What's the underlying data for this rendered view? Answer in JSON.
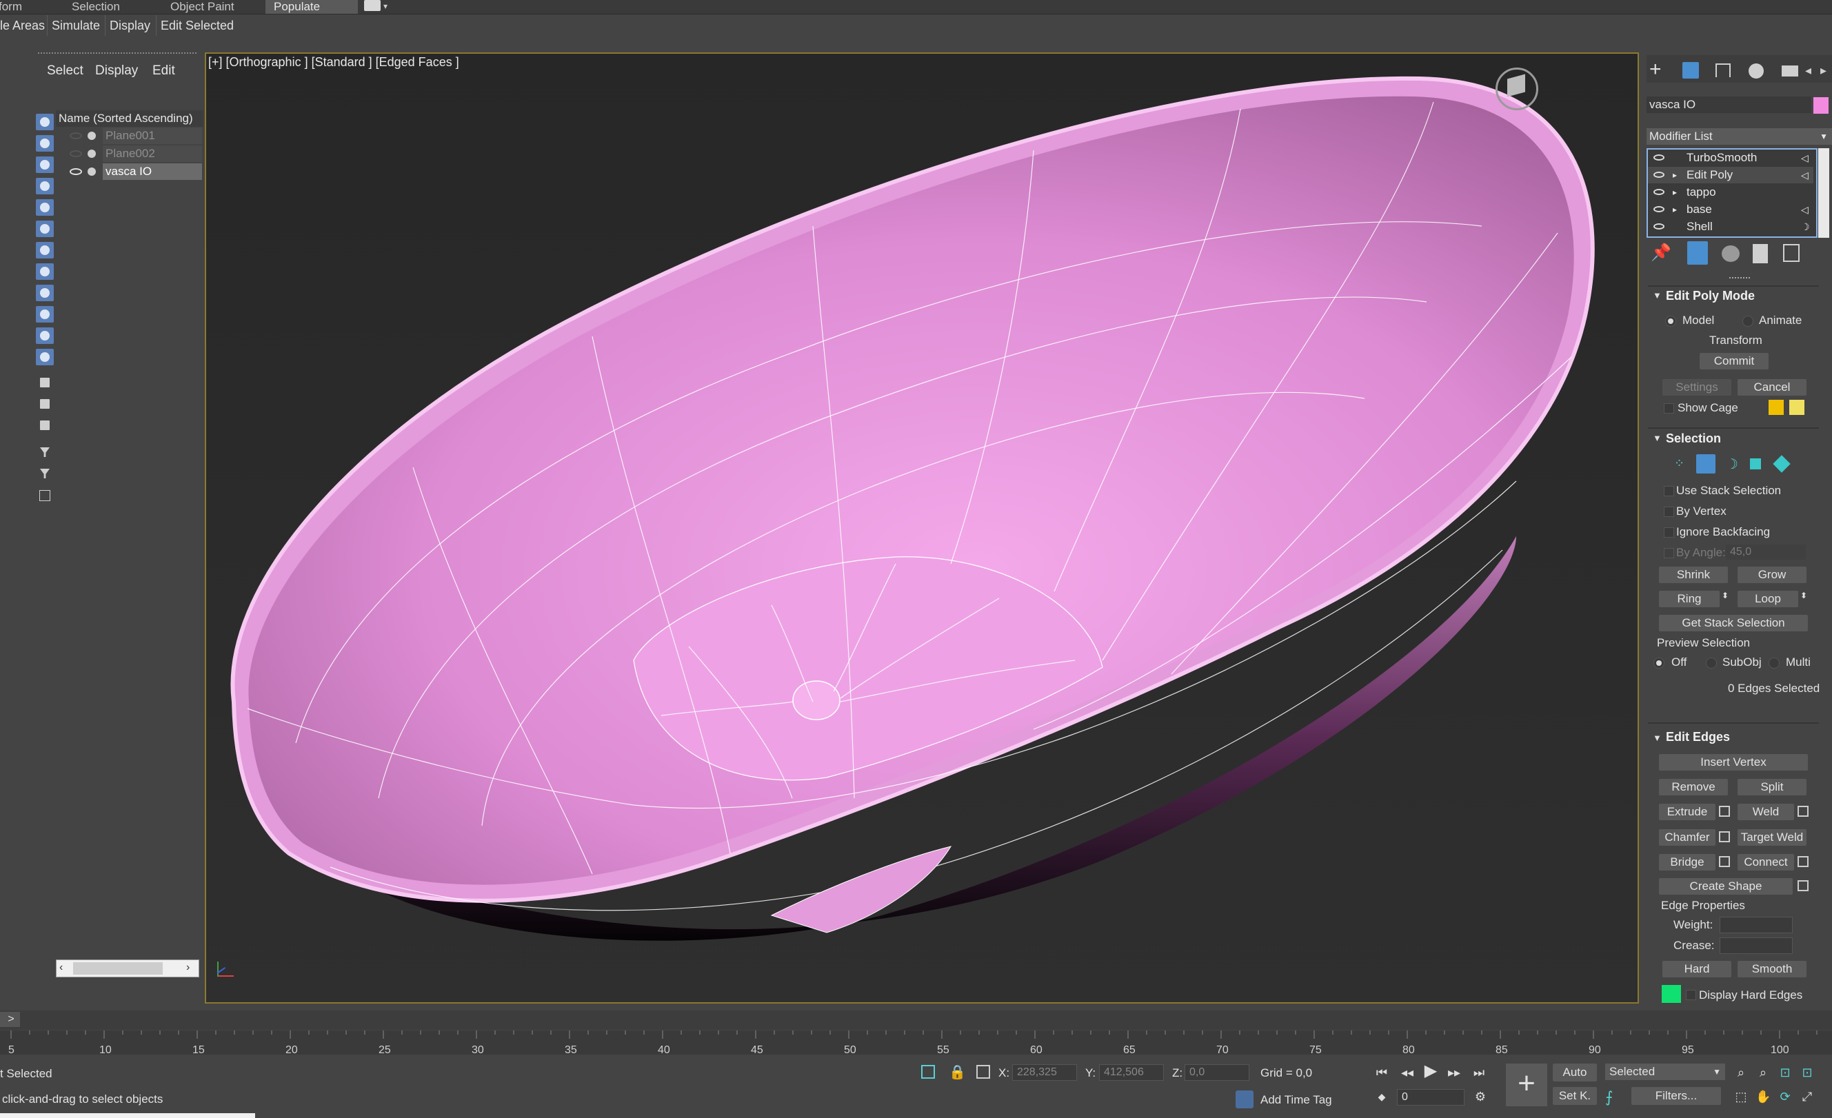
{
  "ribbon": {
    "tabs": [
      "form",
      "Selection",
      "Object Paint",
      "Populate"
    ],
    "active_tab": "Populate",
    "subtabs": [
      "le Areas",
      "Simulate",
      "Display",
      "Edit Selected"
    ]
  },
  "explorer": {
    "menu": [
      "Select",
      "Display",
      "Edit"
    ],
    "header": "Name (Sorted Ascending)",
    "rows": [
      {
        "name": "Plane001",
        "selected": false
      },
      {
        "name": "Plane002",
        "selected": false
      },
      {
        "name": "vasca IO",
        "selected": true
      }
    ]
  },
  "viewport": {
    "label": "[+] [Orthographic ] [Standard ] [Edged Faces ]",
    "object_color": "#E7A1E0",
    "border_color": "#8A7A2E"
  },
  "command_panel": {
    "object_name": "vasca IO",
    "object_swatch": "#F28AE0",
    "modifier_list_label": "Modifier List",
    "stack": [
      "TurboSmooth",
      "Edit Poly",
      "tappo",
      "base",
      "Shell"
    ],
    "edit_poly_mode": {
      "title": "Edit Poly Mode",
      "model": "Model",
      "animate": "Animate",
      "transform": "Transform",
      "commit": "Commit",
      "settings": "Settings",
      "cancel": "Cancel",
      "show_cage": "Show Cage"
    },
    "selection": {
      "title": "Selection",
      "use_stack": "Use Stack Selection",
      "by_vertex": "By Vertex",
      "ignore_backfacing": "Ignore Backfacing",
      "by_angle": "By Angle:",
      "angle_value": "45,0",
      "shrink": "Shrink",
      "grow": "Grow",
      "ring": "Ring",
      "loop": "Loop",
      "get_stack": "Get Stack Selection",
      "preview": "Preview Selection",
      "off": "Off",
      "subobj": "SubObj",
      "multi": "Multi",
      "status": "0 Edges Selected"
    },
    "edit_edges": {
      "title": "Edit Edges",
      "insert_vertex": "Insert Vertex",
      "remove": "Remove",
      "split": "Split",
      "extrude": "Extrude",
      "weld": "Weld",
      "chamfer": "Chamfer",
      "target_weld": "Target Weld",
      "bridge": "Bridge",
      "connect": "Connect",
      "create_shape": "Create Shape",
      "edge_properties": "Edge Properties",
      "weight": "Weight:",
      "crease": "Crease:",
      "hard": "Hard",
      "smooth": "Smooth",
      "display_hard_edges": "Display Hard Edges"
    }
  },
  "timeline": {
    "ticks": [
      "5",
      "10",
      "15",
      "20",
      "25",
      "30",
      "35",
      "40",
      "45",
      "50",
      "55",
      "60",
      "65",
      "70",
      "75",
      "80",
      "85",
      "90",
      "95",
      "100"
    ]
  },
  "status": {
    "selected_text": "t Selected",
    "prompt": "click-and-drag to select objects",
    "x_label": "X:",
    "x_value": "228,325",
    "y_label": "Y:",
    "y_value": "412,506",
    "z_label": "Z:",
    "z_value": "0,0",
    "grid": "Grid = 0,0",
    "add_time_tag": "Add Time Tag",
    "auto": "Auto",
    "set_key": "Set K.",
    "selected_dropdown": "Selected",
    "filters": "Filters...",
    "frame": "0"
  }
}
